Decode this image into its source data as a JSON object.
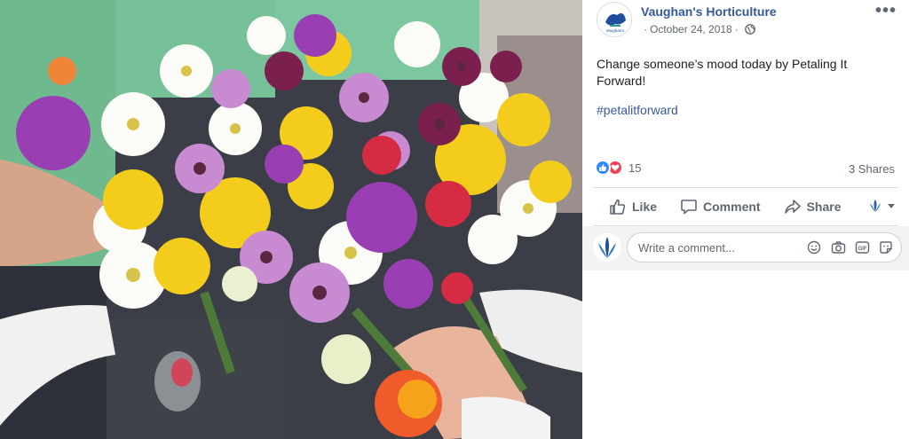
{
  "post": {
    "page_name": "Vaughan's Horticulture",
    "date": "October 24, 2018",
    "separator": "·",
    "more": "•••",
    "text": "Change someone’s mood today by Petaling It Forward!",
    "hashtag": "#petalitforward",
    "reaction_count": "15",
    "shares": "3 Shares"
  },
  "actions": {
    "like": "Like",
    "comment": "Comment",
    "share": "Share"
  },
  "comment": {
    "placeholder": "Write a comment..."
  },
  "colors": {
    "brand_blue": "#365899",
    "like_blue": "#2e89ff",
    "love_red": "#f33e58"
  },
  "icons": [
    "globe-icon",
    "more-icon",
    "like-reaction-icon",
    "love-reaction-icon",
    "thumbs-up-icon",
    "comment-bubble-icon",
    "share-arrow-icon",
    "audience-selector-icon",
    "emoji-icon",
    "camera-icon",
    "gif-icon",
    "sticker-icon"
  ]
}
